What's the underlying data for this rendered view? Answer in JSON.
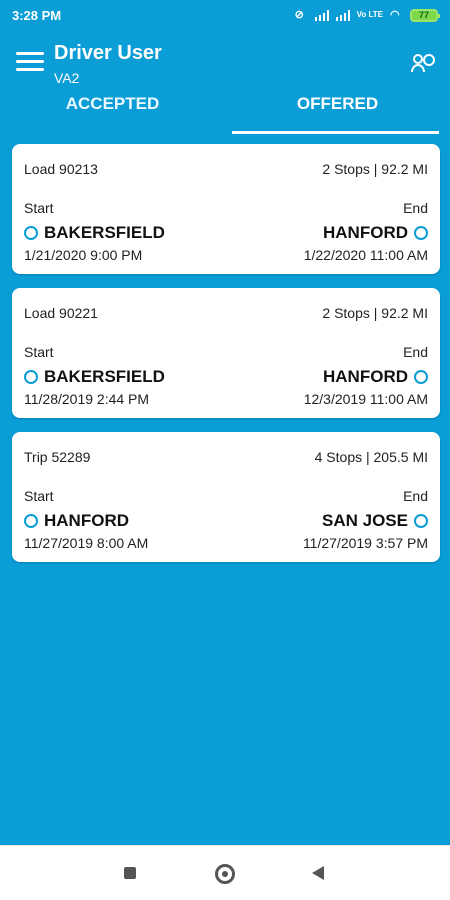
{
  "status_bar": {
    "time": "3:28 PM",
    "signal_label": "Vo LTE",
    "battery": "77",
    "icons": [
      "signal-icon",
      "signal-icon",
      "wifi-icon",
      "battery-icon",
      "notification-icon"
    ]
  },
  "header": {
    "title": "Driver User",
    "subtitle": "VA2",
    "menu_icon": "menu-icon",
    "right_icon": "user-switch-icon"
  },
  "tabs": [
    {
      "label": "ACCEPTED",
      "active": false
    },
    {
      "label": "OFFERED",
      "active": true
    }
  ],
  "cards": [
    {
      "title": "Load 90213",
      "summary": "2 Stops | 92.2 MI",
      "start_label": "Start",
      "end_label": "End",
      "from": "BAKERSFIELD",
      "to": "HANFORD",
      "start_time": "1/21/2020 9:00 PM",
      "end_time": "1/22/2020 11:00 AM"
    },
    {
      "title": "Load 90221",
      "summary": "2 Stops | 92.2 MI",
      "start_label": "Start",
      "end_label": "End",
      "from": "BAKERSFIELD",
      "to": "HANFORD",
      "start_time": "11/28/2019 2:44 PM",
      "end_time": "12/3/2019 11:00 AM"
    },
    {
      "title": "Trip 52289",
      "summary": "4 Stops | 205.5 MI",
      "start_label": "Start",
      "end_label": "End",
      "from": "HANFORD",
      "to": "SAN JOSE",
      "start_time": "11/27/2019 8:00 AM",
      "end_time": "11/27/2019 3:57 PM"
    }
  ],
  "navbar": {
    "buttons": [
      "recent-apps-button",
      "home-button",
      "back-button"
    ]
  },
  "colors": {
    "primary": "#0a9dd6",
    "card_bg": "#ffffff",
    "text": "#222222"
  }
}
